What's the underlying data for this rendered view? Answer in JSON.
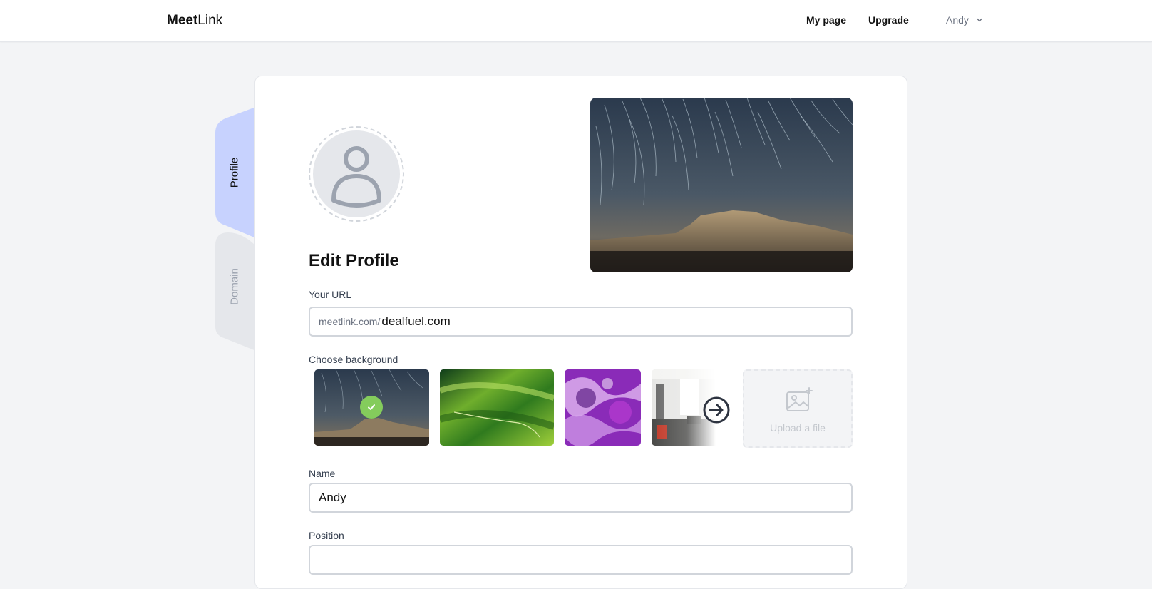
{
  "brand": {
    "bold": "Meet",
    "light": "Link"
  },
  "nav": {
    "my_page": "My page",
    "upgrade": "Upgrade",
    "user": "Andy"
  },
  "tabs": {
    "profile": "Profile",
    "domain": "Domain"
  },
  "page": {
    "title": "Edit Profile"
  },
  "url_field": {
    "label": "Your URL",
    "prefix": "meetlink.com/",
    "value": "dealfuel.com"
  },
  "background": {
    "label": "Choose background",
    "options": [
      "night-sky-mesa",
      "green-hills",
      "purple-marble",
      "office-interior"
    ],
    "selected": "night-sky-mesa",
    "upload_label": "Upload a file"
  },
  "name_field": {
    "label": "Name",
    "value": "Andy"
  },
  "position_field": {
    "label": "Position",
    "value": ""
  },
  "colors": {
    "accent_tab": "#c7d2fe",
    "inactive_tab": "#e5e7eb",
    "check": "#84cc5c",
    "page_bg": "#f3f4f6"
  }
}
